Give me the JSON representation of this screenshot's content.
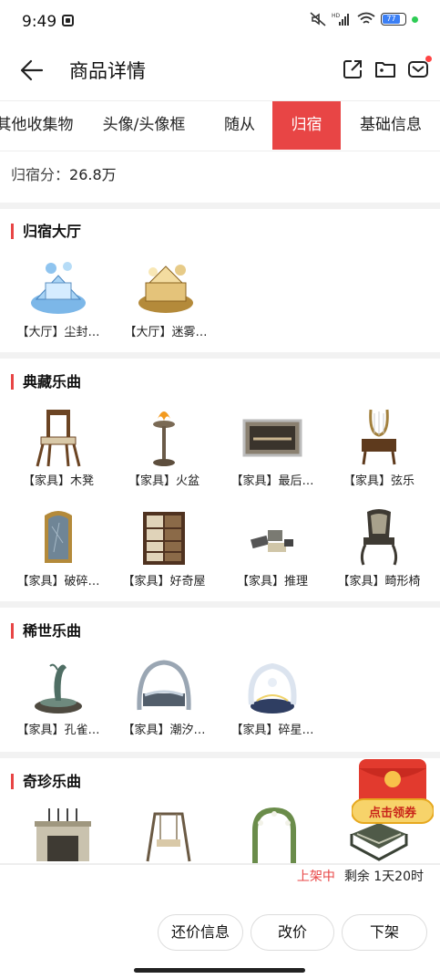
{
  "status_bar": {
    "time": "9:49",
    "network": "HD",
    "battery": "77"
  },
  "header": {
    "title": "商品详情"
  },
  "tabs": [
    "其他收集物",
    "头像/头像框",
    "随从",
    "归宿",
    "基础信息"
  ],
  "active_tab": "归宿",
  "score": {
    "label": "归宿分：",
    "value": "26.8万"
  },
  "sections": [
    {
      "title": "归宿大厅",
      "items": [
        "【大厅】尘封…",
        "【大厅】迷雾…"
      ]
    },
    {
      "title": "典藏乐曲",
      "items": [
        "【家具】木凳",
        "【家具】火盆",
        "【家具】最后…",
        "【家具】弦乐",
        "【家具】破碎…",
        "【家具】好奇屋",
        "【家具】推理",
        "【家具】畸形椅"
      ]
    },
    {
      "title": "稀世乐曲",
      "items": [
        "【家具】孔雀…",
        "【家具】潮汐…",
        "【家具】碎星…"
      ]
    },
    {
      "title": "奇珍乐曲",
      "items": []
    }
  ],
  "coupon": {
    "label": "点击领券"
  },
  "listing": {
    "state": "上架中",
    "remaining": "剩余 1天20时"
  },
  "actions": {
    "bargain": "还价信息",
    "reprice": "改价",
    "delist": "下架"
  },
  "accent_color": "#e84545"
}
